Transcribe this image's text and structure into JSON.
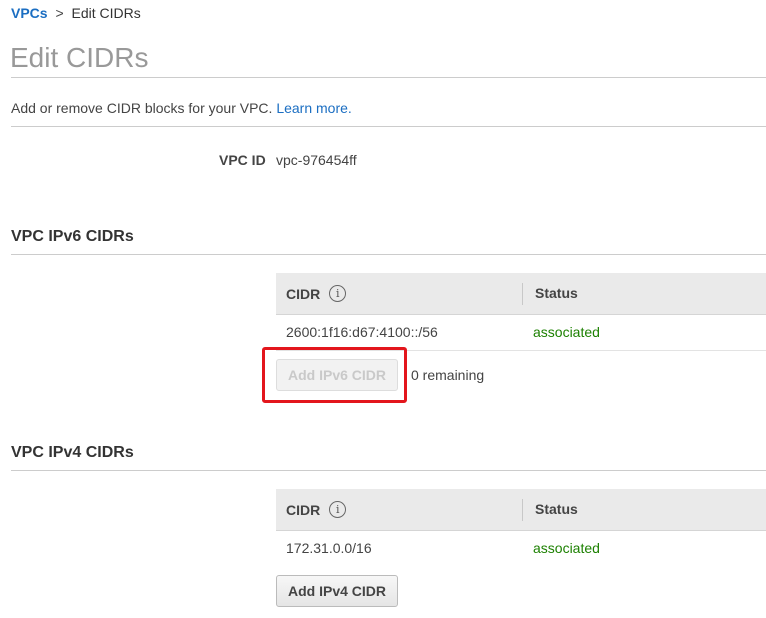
{
  "breadcrumb": {
    "root": "VPCs",
    "separator": ">",
    "current": "Edit CIDRs"
  },
  "page": {
    "title": "Edit CIDRs",
    "intro_text": "Add or remove CIDR blocks for your VPC.",
    "learn_more": "Learn more."
  },
  "vpc": {
    "id_label": "VPC ID",
    "id_value": "vpc-976454ff"
  },
  "ipv6": {
    "section_title": "VPC IPv6 CIDRs",
    "columns": {
      "cidr": "CIDR",
      "status": "Status"
    },
    "rows": [
      {
        "cidr": "2600:1f16:d67:4100::/56",
        "status": "associated"
      }
    ],
    "add_button": "Add IPv6 CIDR",
    "add_button_disabled": true,
    "remaining": "0 remaining"
  },
  "ipv4": {
    "section_title": "VPC IPv4 CIDRs",
    "columns": {
      "cidr": "CIDR",
      "status": "Status"
    },
    "rows": [
      {
        "cidr": "172.31.0.0/16",
        "status": "associated"
      }
    ],
    "add_button": "Add IPv4 CIDR"
  },
  "info_icon_glyph": "i",
  "colors": {
    "link": "#1b6ec2",
    "status_associated": "#1d8102",
    "highlight": "#e3161c",
    "title_gray": "#999999"
  }
}
